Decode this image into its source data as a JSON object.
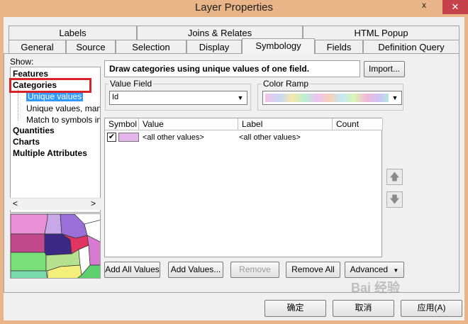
{
  "window": {
    "title": "Layer Properties",
    "close_glyph": "x",
    "corner_glyph": "✕"
  },
  "tabs_row1": [
    "Labels",
    "Joins & Relates",
    "HTML Popup"
  ],
  "tabs_row2": [
    "General",
    "Source",
    "Selection",
    "Display",
    "Symbology",
    "Fields",
    "Definition Query"
  ],
  "active_tab": "Symbology",
  "show": {
    "label": "Show:",
    "items": [
      {
        "label": "Features",
        "bold": true
      },
      {
        "label": "Categories",
        "bold": true
      },
      {
        "label": "Unique values",
        "selected": true
      },
      {
        "label": "Unique values, many f"
      },
      {
        "label": "Match to symbols in a"
      },
      {
        "label": "Quantities",
        "bold": true
      },
      {
        "label": "Charts",
        "bold": true
      },
      {
        "label": "Multiple Attributes",
        "bold": true
      }
    ],
    "scroll_left": "<",
    "scroll_right": ">"
  },
  "description": "Draw categories using unique values of one field.",
  "import_button": "Import...",
  "value_field": {
    "label": "Value Field",
    "value": "Id"
  },
  "color_ramp": {
    "label": "Color Ramp"
  },
  "table": {
    "headers": [
      "Symbol",
      "Value",
      "Label",
      "Count"
    ],
    "rows": [
      {
        "checked": true,
        "value": "<all other values>",
        "label": "<all other values>",
        "count": ""
      }
    ]
  },
  "actions": {
    "add_all": "Add All Values",
    "add_values": "Add Values...",
    "remove": "Remove",
    "remove_all": "Remove All",
    "advanced": "Advanced"
  },
  "footer": {
    "ok": "确定",
    "cancel": "取消",
    "apply": "应用(A)"
  },
  "watermark": "Bai 经验"
}
